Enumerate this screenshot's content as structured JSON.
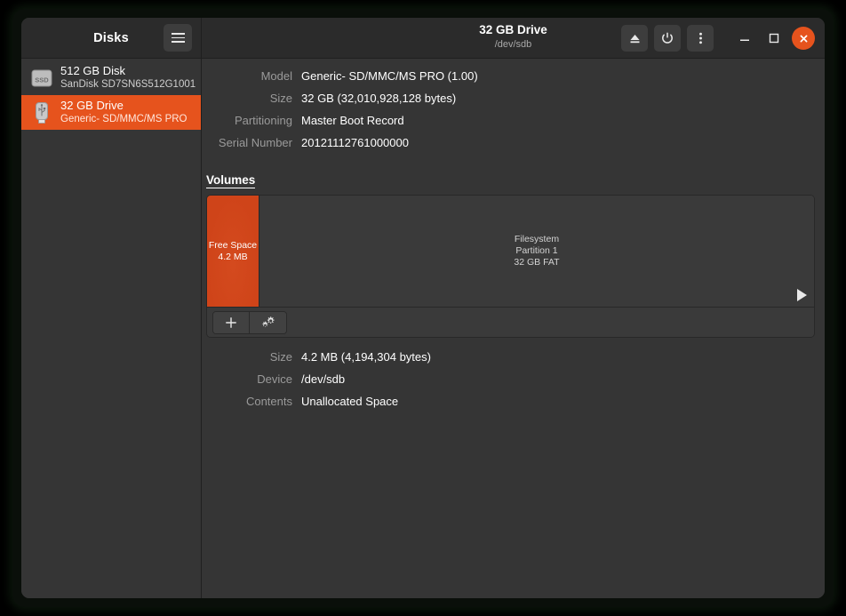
{
  "window": {
    "app_title": "Disks",
    "header_title": "32 GB Drive",
    "header_subtitle": "/dev/sdb",
    "accent_color": "#e6531d",
    "bg_color": "#353535",
    "titlebar_color": "#2b2b2b"
  },
  "titlebar_buttons": [
    {
      "name": "eject-button",
      "label": "Eject"
    },
    {
      "name": "power-button",
      "label": "Power Off"
    },
    {
      "name": "menu-button",
      "label": "Menu"
    },
    {
      "name": "minimize-button",
      "label": "Minimize"
    },
    {
      "name": "maximize-button",
      "label": "Maximize"
    },
    {
      "name": "close-button",
      "label": "Close"
    }
  ],
  "sidebar": {
    "hamburger_label": "Main Menu",
    "items": [
      {
        "title": "512 GB Disk",
        "subtitle": "SanDisk SD7SN6S512G1001",
        "icon": "ssd-icon",
        "icon_label": "SSD",
        "selected": false
      },
      {
        "title": "32 GB Drive",
        "subtitle": "Generic- SD/MMC/MS PRO",
        "icon": "usb-drive-icon",
        "icon_label": "",
        "selected": true
      }
    ]
  },
  "drive_properties": [
    {
      "key": "Model",
      "value": "Generic- SD/MMC/MS PRO (1.00)"
    },
    {
      "key": "Size",
      "value": "32 GB (32,010,928,128 bytes)"
    },
    {
      "key": "Partitioning",
      "value": "Master Boot Record"
    },
    {
      "key": "Serial Number",
      "value": "20121112761000000"
    }
  ],
  "volumes": {
    "section_label": "Volumes",
    "segments": [
      {
        "name": "free-space-segment",
        "lines": [
          "Free Space",
          "4.2 MB"
        ],
        "selected": true,
        "color": "#cf4419"
      },
      {
        "name": "partition-1-segment",
        "lines": [
          "Filesystem",
          "Partition 1",
          "32 GB FAT"
        ],
        "selected": false,
        "color": "#3a3a3a"
      }
    ],
    "toolbar": [
      {
        "name": "create-partition-button",
        "icon": "plus-icon",
        "label": "+"
      },
      {
        "name": "additional-partition-options-button",
        "icon": "gears-icon",
        "label": ""
      }
    ],
    "scroll_arrow": "play-arrow-icon"
  },
  "volume_details": [
    {
      "key": "Size",
      "value": "4.2 MB (4,194,304 bytes)"
    },
    {
      "key": "Device",
      "value": "/dev/sdb"
    },
    {
      "key": "Contents",
      "value": "Unallocated Space"
    }
  ]
}
